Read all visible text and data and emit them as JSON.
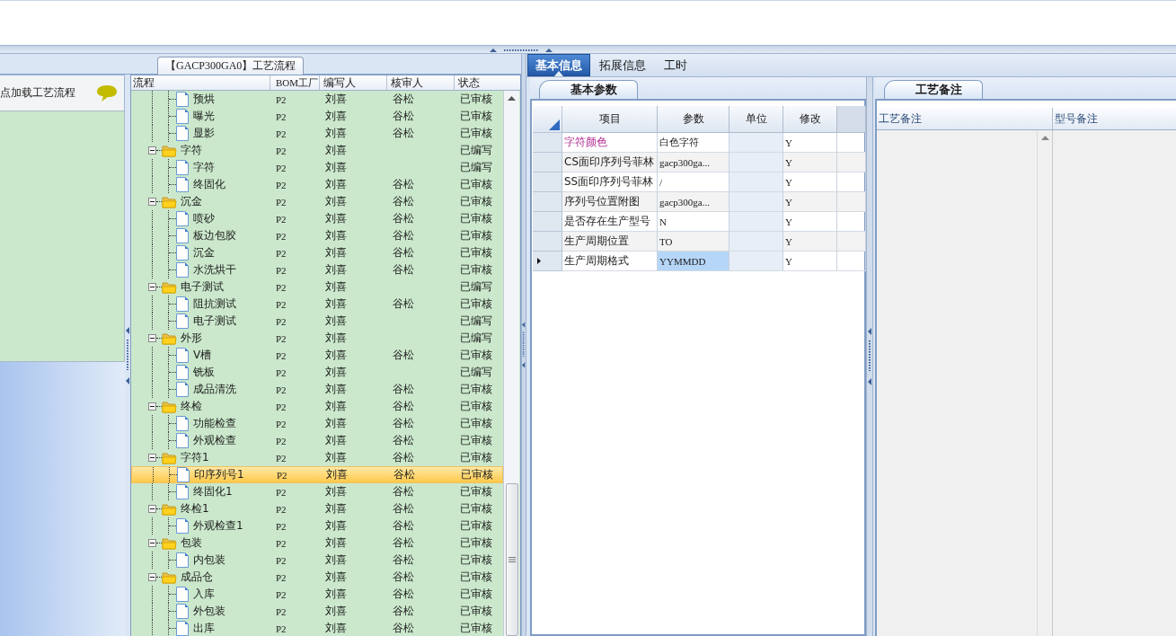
{
  "process_panel": {
    "title": "【GACP300GA0】工艺流程",
    "hint": "点加载工艺流程"
  },
  "process_tree": {
    "columns": [
      "流程",
      "BOM工厂",
      "编写人",
      "核审人",
      "状态"
    ],
    "rows": [
      {
        "children": [
          {
            "kind": "file",
            "label": "预烘",
            "selected": false,
            "bom": "P2",
            "writer": "刘喜",
            "reviewer": "谷松",
            "status": "已审核"
          },
          {
            "kind": "file",
            "label": "曝光",
            "selected": false,
            "bom": "P2",
            "writer": "刘喜",
            "reviewer": "谷松",
            "status": "已审核"
          },
          {
            "kind": "file",
            "label": "显影",
            "selected": false,
            "bom": "P2",
            "writer": "刘喜",
            "reviewer": "谷松",
            "status": "已审核"
          }
        ]
      },
      {
        "kind": "folder",
        "label": "字符",
        "expanded": true,
        "selected": false,
        "bom": "P2",
        "writer": "刘喜",
        "status": "已编写",
        "children": [
          {
            "kind": "file",
            "label": "字符",
            "selected": false,
            "bom": "P2",
            "writer": "刘喜",
            "status": "已编写"
          },
          {
            "kind": "file",
            "label": "终固化",
            "selected": false,
            "bom": "P2",
            "writer": "刘喜",
            "reviewer": "谷松",
            "status": "已审核"
          }
        ]
      },
      {
        "kind": "folder",
        "label": "沉金",
        "expanded": true,
        "selected": false,
        "bom": "P2",
        "writer": "刘喜",
        "reviewer": "谷松",
        "status": "已审核",
        "children": [
          {
            "kind": "file",
            "label": "喷砂",
            "selected": false,
            "bom": "P2",
            "writer": "刘喜",
            "reviewer": "谷松",
            "status": "已审核"
          },
          {
            "kind": "file",
            "label": "板边包胶",
            "selected": false,
            "bom": "P2",
            "writer": "刘喜",
            "reviewer": "谷松",
            "status": "已审核"
          },
          {
            "kind": "file",
            "label": "沉金",
            "selected": false,
            "bom": "P2",
            "writer": "刘喜",
            "reviewer": "谷松",
            "status": "已审核"
          },
          {
            "kind": "file",
            "label": "水洗烘干",
            "selected": false,
            "bom": "P2",
            "writer": "刘喜",
            "reviewer": "谷松",
            "status": "已审核"
          }
        ]
      },
      {
        "kind": "folder",
        "label": "电子测试",
        "expanded": true,
        "selected": false,
        "bom": "P2",
        "writer": "刘喜",
        "status": "已编写",
        "children": [
          {
            "kind": "file",
            "label": "阻抗测试",
            "selected": false,
            "bom": "P2",
            "writer": "刘喜",
            "reviewer": "谷松",
            "status": "已审核"
          },
          {
            "kind": "file",
            "label": "电子测试",
            "selected": false,
            "bom": "P2",
            "writer": "刘喜",
            "status": "已编写"
          }
        ]
      },
      {
        "kind": "folder",
        "label": "外形",
        "expanded": true,
        "selected": false,
        "bom": "P2",
        "writer": "刘喜",
        "status": "已编写",
        "children": [
          {
            "kind": "file",
            "label": "V槽",
            "selected": false,
            "bom": "P2",
            "writer": "刘喜",
            "reviewer": "谷松",
            "status": "已审核"
          },
          {
            "kind": "file",
            "label": "铣板",
            "selected": false,
            "bom": "P2",
            "writer": "刘喜",
            "status": "已编写"
          },
          {
            "kind": "file",
            "label": "成品清洗",
            "selected": false,
            "bom": "P2",
            "writer": "刘喜",
            "reviewer": "谷松",
            "status": "已审核"
          }
        ]
      },
      {
        "kind": "folder",
        "label": "终检",
        "expanded": true,
        "selected": false,
        "bom": "P2",
        "writer": "刘喜",
        "reviewer": "谷松",
        "status": "已审核",
        "children": [
          {
            "kind": "file",
            "label": "功能检查",
            "selected": false,
            "bom": "P2",
            "writer": "刘喜",
            "reviewer": "谷松",
            "status": "已审核"
          },
          {
            "kind": "file",
            "label": "外观检查",
            "selected": false,
            "bom": "P2",
            "writer": "刘喜",
            "reviewer": "谷松",
            "status": "已审核"
          }
        ]
      },
      {
        "kind": "folder",
        "label": "字符1",
        "expanded": true,
        "selected": false,
        "bom": "P2",
        "writer": "刘喜",
        "reviewer": "谷松",
        "status": "已审核",
        "children": [
          {
            "kind": "file",
            "label": "印序列号1",
            "selected": true,
            "bom": "P2",
            "writer": "刘喜",
            "reviewer": "谷松",
            "status": "已审核"
          },
          {
            "kind": "file",
            "label": "终固化1",
            "selected": false,
            "bom": "P2",
            "writer": "刘喜",
            "reviewer": "谷松",
            "status": "已审核"
          }
        ]
      },
      {
        "kind": "folder",
        "label": "终检1",
        "expanded": true,
        "selected": false,
        "bom": "P2",
        "writer": "刘喜",
        "reviewer": "谷松",
        "status": "已审核",
        "children": [
          {
            "kind": "file",
            "label": "外观检查1",
            "selected": false,
            "bom": "P2",
            "writer": "刘喜",
            "reviewer": "谷松",
            "status": "已审核"
          }
        ]
      },
      {
        "kind": "folder",
        "label": "包装",
        "expanded": true,
        "selected": false,
        "bom": "P2",
        "writer": "刘喜",
        "reviewer": "谷松",
        "status": "已审核",
        "children": [
          {
            "kind": "file",
            "label": "内包装",
            "selected": false,
            "bom": "P2",
            "writer": "刘喜",
            "reviewer": "谷松",
            "status": "已审核"
          }
        ]
      },
      {
        "kind": "folder",
        "label": "成品仓",
        "expanded": true,
        "selected": false,
        "bom": "P2",
        "writer": "刘喜",
        "reviewer": "谷松",
        "status": "已审核",
        "children": [
          {
            "kind": "file",
            "label": "入库",
            "selected": false,
            "bom": "P2",
            "writer": "刘喜",
            "reviewer": "谷松",
            "status": "已审核"
          },
          {
            "kind": "file",
            "label": "外包装",
            "selected": false,
            "bom": "P2",
            "writer": "刘喜",
            "reviewer": "谷松",
            "status": "已审核"
          },
          {
            "kind": "file",
            "label": "出库",
            "selected": false,
            "bom": "P2",
            "writer": "刘喜",
            "reviewer": "谷松",
            "status": "已审核"
          }
        ]
      }
    ]
  },
  "detail_tabs": [
    {
      "label": "基本信息",
      "selected": true
    },
    {
      "label": "拓展信息",
      "selected": false
    },
    {
      "label": "工时",
      "selected": false
    }
  ],
  "params": {
    "tab": "基本参数",
    "columns": [
      "项目",
      "参数",
      "单位",
      "修改"
    ],
    "rows": [
      {
        "item": "字符颜色",
        "highlighted": true,
        "value": "白色字符",
        "modified": "Y",
        "selected": false
      },
      {
        "item": "CS面印序列号菲林",
        "highlighted": false,
        "value": "gacp300ga...",
        "modified": "Y",
        "selected": false
      },
      {
        "item": "SS面印序列号菲林",
        "highlighted": false,
        "value": "/",
        "modified": "Y",
        "selected": false
      },
      {
        "item": "序列号位置附图",
        "highlighted": false,
        "value": "gacp300ga...",
        "modified": "Y",
        "selected": false
      },
      {
        "item": "是否存在生产型号",
        "highlighted": false,
        "value": "N",
        "modified": "Y",
        "selected": false
      },
      {
        "item": "生产周期位置",
        "highlighted": false,
        "value": "TO",
        "modified": "Y",
        "selected": false
      },
      {
        "item": "生产周期格式",
        "highlighted": false,
        "value": "YYMMDD",
        "modified": "Y",
        "selected": true
      }
    ]
  },
  "notes": {
    "tab": "工艺备注",
    "columns": [
      "工艺备注",
      "型号备注"
    ]
  }
}
